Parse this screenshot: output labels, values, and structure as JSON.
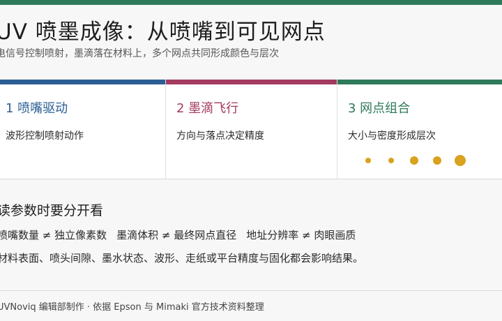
{
  "header": {
    "title": "UV 喷墨成像：从喷嘴到可见网点",
    "subtitle": "电信号控制喷射，墨滴落在材料上，多个网点共同形成颜色与层次"
  },
  "cards": [
    {
      "title": "1  喷嘴驱动",
      "text": "波形控制喷射动作",
      "accent": "#2b5f94"
    },
    {
      "title": "2  墨滴飞行",
      "text": "方向与落点决定精度",
      "accent": "#a33a5f"
    },
    {
      "title": "3  网点组合",
      "text": "大小与密度形成层次",
      "accent": "#2e7a5a",
      "dot_color": "#d9a21f",
      "dot_sizes": [
        "small",
        "small",
        "medium",
        "medium",
        "large"
      ]
    }
  ],
  "notes": {
    "title": "读参数时要分开看",
    "comparisons": [
      "喷嘴数量 ≠ 独立像素数",
      "墨滴体积 ≠ 最终网点直径",
      "地址分辨率 ≠ 肉眼画质"
    ],
    "detail": "材料表面、喷头间隙、墨水状态、波形、走纸或平台精度与固化都会影响结果。"
  },
  "footer": {
    "text": "UVNoviq 编辑部制作 · 依据 Epson 与 Mimaki 官方技术资料整理"
  },
  "colors": {
    "top_bar": "#2e7a5a",
    "background": "#f6f7f6"
  }
}
